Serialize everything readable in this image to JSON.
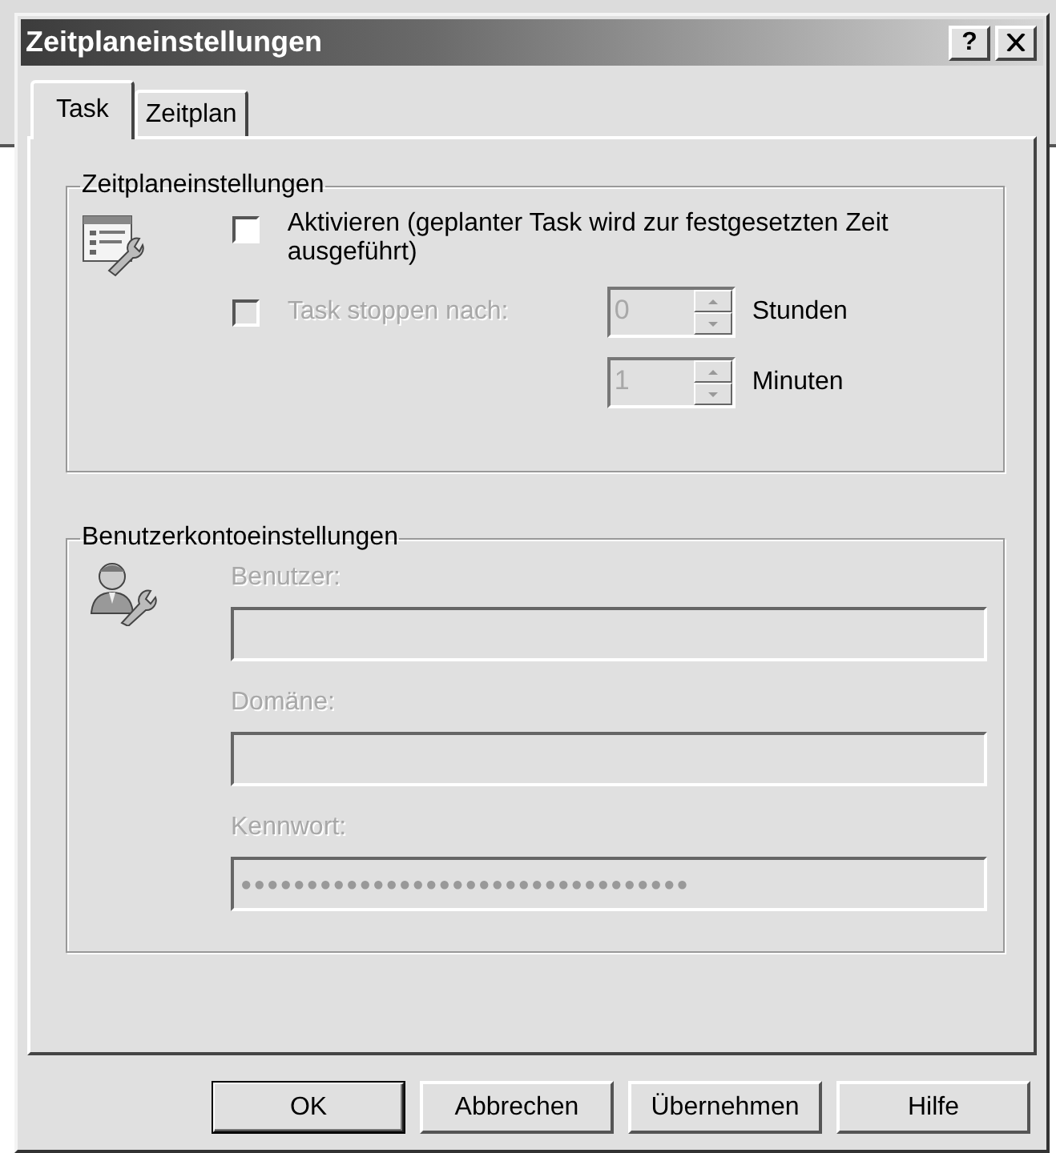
{
  "window": {
    "title": "Zeitplaneinstellungen",
    "help_button": "?"
  },
  "tabs": [
    {
      "label": "Task",
      "selected": true
    },
    {
      "label": "Zeitplan",
      "selected": false
    }
  ],
  "schedule_group": {
    "title": "Zeitplaneinstellungen",
    "enable": {
      "label": "Aktivieren (geplanter Task wird zur festgesetzten Zeit ausgeführt)",
      "checked": false,
      "disabled": false
    },
    "stop_after": {
      "label": "Task stoppen nach:",
      "checked": false,
      "disabled": true
    },
    "durations": [
      {
        "value": "0",
        "unit": "Stunden",
        "disabled": true
      },
      {
        "value": "1",
        "unit": "Minuten",
        "disabled": true
      }
    ]
  },
  "account_group": {
    "title": "Benutzerkontoeinstellungen",
    "fields": [
      {
        "label": "Benutzer:",
        "disabled": true
      },
      {
        "label": "Domäne:",
        "disabled": true
      },
      {
        "label": "Kennwort:",
        "value": "●●●●●●●●●●●●●●●●●●●●●●●●●●●●●●●●●●",
        "disabled": true
      }
    ]
  },
  "buttons": [
    {
      "label": "OK",
      "default": true
    },
    {
      "label": "Abbrechen",
      "default": false
    },
    {
      "label": "Übernehmen",
      "default": false
    },
    {
      "label": "Hilfe",
      "default": false
    }
  ]
}
